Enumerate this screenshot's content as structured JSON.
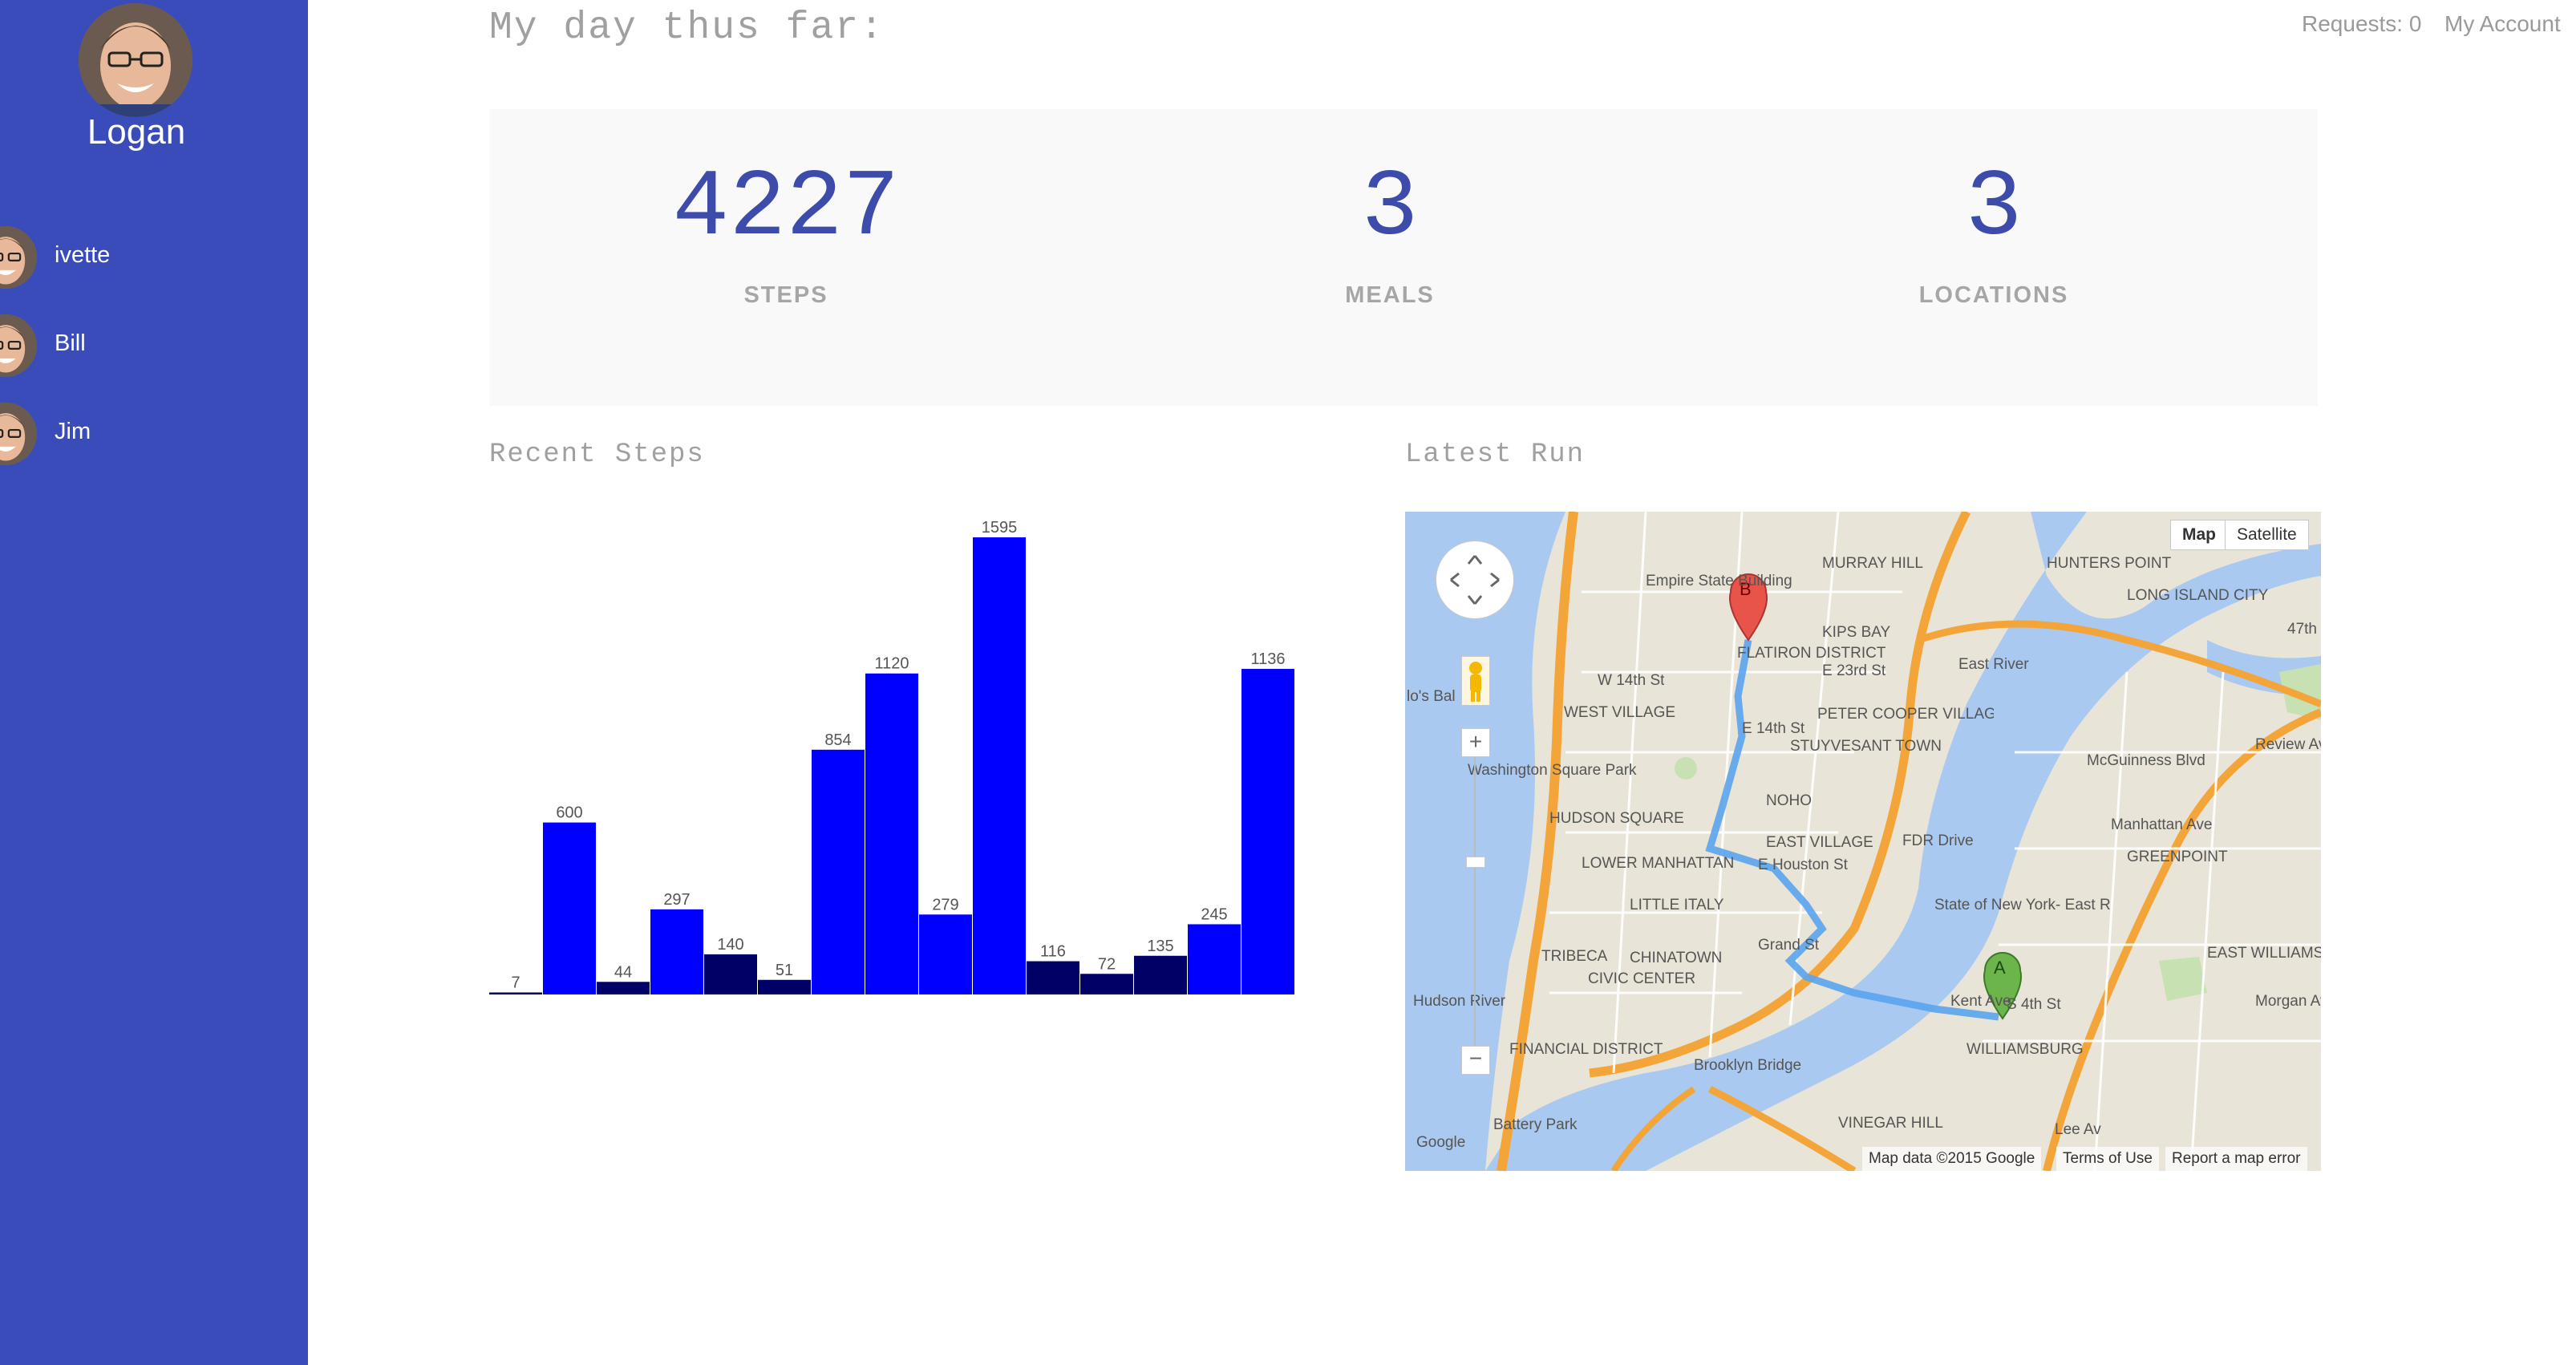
{
  "sidebar": {
    "user": {
      "name": "Logan"
    },
    "friends": [
      {
        "name": "ivette"
      },
      {
        "name": "Bill"
      },
      {
        "name": "Jim"
      }
    ]
  },
  "topnav": {
    "requests": "Requests: 0",
    "account": "My Account"
  },
  "headline": "My day thus far:",
  "stats": [
    {
      "value": "4227",
      "label": "STEPS"
    },
    {
      "value": "3",
      "label": "MEALS"
    },
    {
      "value": "3",
      "label": "LOCATIONS"
    }
  ],
  "recent_steps": {
    "title": "Recent Steps"
  },
  "latest_run": {
    "title": "Latest Run",
    "map_toggle": {
      "map": "Map",
      "satellite": "Satellite"
    },
    "footer": {
      "data": "Map data ©2015 Google",
      "terms": "Terms of Use",
      "report": "Report a map error"
    },
    "labels": [
      "Empire State Building",
      "MURRAY HILL",
      "KIPS BAY",
      "FLATIRON DISTRICT",
      "WEST VILLAGE",
      "PETER COOPER VILLAGE",
      "STUYVESANT TOWN",
      "Washington Square Park",
      "HUDSON SQUARE",
      "NOHO",
      "EAST VILLAGE",
      "LOWER MANHATTAN",
      "LITTLE ITALY",
      "TRIBECA",
      "CHINATOWN",
      "CIVIC CENTER",
      "FINANCIAL DISTRICT",
      "Battery Park",
      "VINEGAR HILL",
      "WILLIAMSBURG",
      "GREENPOINT",
      "HUNTERS POINT",
      "LONG ISLAND CITY",
      "EAST WILLIAMSBURG",
      "State of New York- East River State Park",
      "Hudson River",
      "East River",
      "FDR Drive",
      "Brooklyn Bridge",
      "E Houston St",
      "Grand St",
      "W 14th St",
      "E 14th St",
      "E 23rd St",
      "McGuinness Blvd",
      "Manhattan Ave",
      "Review Ave",
      "Morgan Ave",
      "Kent Ave",
      "S 4th St",
      "Lee Av",
      "47th",
      "lo's Bal",
      "Google"
    ],
    "markers": {
      "start": "A",
      "end": "B"
    },
    "colors": {
      "water": "#a9c9f0",
      "land": "#e9e4d8",
      "park": "#c7e1b2",
      "highway": "#f3a53a",
      "route": "#5aa4ee",
      "marker_a": "#6bb54a",
      "marker_b": "#e8534a"
    }
  },
  "chart_data": {
    "type": "bar",
    "values": [
      7,
      600,
      44,
      297,
      140,
      51,
      854,
      1120,
      279,
      1595,
      116,
      72,
      135,
      245,
      1136
    ],
    "ylim": [
      0,
      1595
    ],
    "colors": {
      "high": "#0000ff",
      "low": "#000066"
    }
  },
  "colors": {
    "sidebar": "#3a4cb9",
    "accent": "#3d4bab"
  }
}
